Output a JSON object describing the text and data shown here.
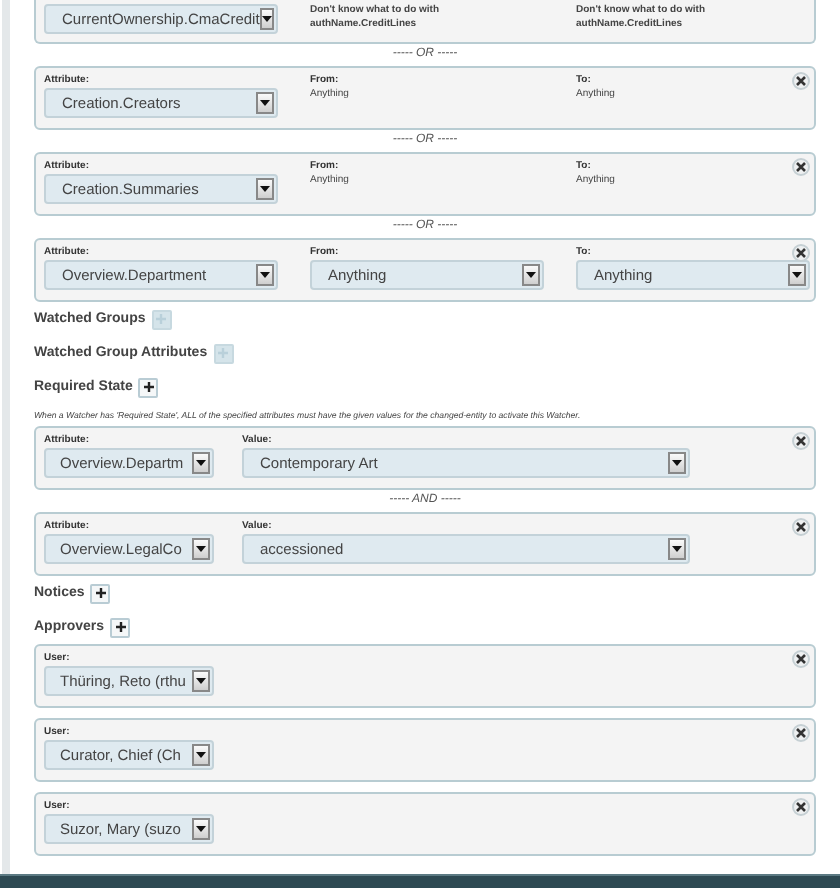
{
  "attribute_changes": {
    "items": [
      {
        "kind": "condition",
        "removable": false,
        "fields": [
          {
            "kind": "dropdown",
            "value": "CurrentOwnership.CmaCredit"
          },
          {
            "kind": "text",
            "lines": [
              "Don't know what to do with",
              "authName.CreditLines"
            ],
            "strong": true
          },
          {
            "kind": "text",
            "lines": [
              "Don't know what to do with",
              "authName.CreditLines"
            ],
            "strong": true
          }
        ]
      },
      {
        "kind": "separator",
        "text": "----- OR -----"
      },
      {
        "kind": "condition",
        "removable": true,
        "fields": [
          {
            "label": "Attribute:",
            "kind": "dropdown",
            "value": "Creation.Creators"
          },
          {
            "label": "From:",
            "kind": "text",
            "lines": [
              "Anything"
            ],
            "strong": false
          },
          {
            "label": "To:",
            "kind": "text",
            "lines": [
              "Anything"
            ],
            "strong": false
          }
        ]
      },
      {
        "kind": "separator",
        "text": "----- OR -----"
      },
      {
        "kind": "condition",
        "removable": true,
        "fields": [
          {
            "label": "Attribute:",
            "kind": "dropdown",
            "value": "Creation.Summaries"
          },
          {
            "label": "From:",
            "kind": "text",
            "lines": [
              "Anything"
            ],
            "strong": false
          },
          {
            "label": "To:",
            "kind": "text",
            "lines": [
              "Anything"
            ],
            "strong": false
          }
        ]
      },
      {
        "kind": "separator",
        "text": "----- OR -----"
      },
      {
        "kind": "condition",
        "removable": true,
        "fields": [
          {
            "label": "Attribute:",
            "kind": "dropdown",
            "value": "Overview.Department"
          },
          {
            "label": "From:",
            "kind": "dropdown",
            "value": "Anything"
          },
          {
            "label": "To:",
            "kind": "dropdown",
            "value": "Anything"
          }
        ]
      }
    ]
  },
  "sections": [
    {
      "heading": "Watched Groups",
      "add_disabled": true
    },
    {
      "heading": "Watched Group Attributes",
      "add_disabled": true
    },
    {
      "heading": "Required State",
      "add_disabled": false,
      "note": "When a Watcher has 'Required State', ALL of the specified attributes must have the given values for the changed-entity to activate this Watcher.",
      "items": [
        {
          "kind": "condition",
          "removable": true,
          "fields": [
            {
              "label": "Attribute:",
              "kind": "dropdown",
              "value": "Overview.Departm"
            },
            {
              "label": "Value:",
              "kind": "dropdown",
              "value": "Contemporary Art"
            }
          ]
        },
        {
          "kind": "separator",
          "text": "----- AND -----"
        },
        {
          "kind": "condition",
          "removable": true,
          "fields": [
            {
              "label": "Attribute:",
              "kind": "dropdown",
              "value": "Overview.LegalCo"
            },
            {
              "label": "Value:",
              "kind": "dropdown",
              "value": "accessioned"
            }
          ]
        }
      ]
    },
    {
      "heading": "Notices",
      "add_disabled": false
    },
    {
      "heading": "Approvers",
      "add_disabled": false,
      "items": [
        {
          "kind": "condition",
          "removable": true,
          "fields": [
            {
              "label": "User:",
              "kind": "dropdown",
              "value": "Thüring, Reto (rthu"
            }
          ]
        },
        {
          "kind": "condition",
          "removable": true,
          "fields": [
            {
              "label": "User:",
              "kind": "dropdown",
              "value": "Curator, Chief (Ch"
            }
          ]
        },
        {
          "kind": "condition",
          "removable": true,
          "fields": [
            {
              "label": "User:",
              "kind": "dropdown",
              "value": "Suzor, Mary (suzo"
            }
          ]
        }
      ]
    }
  ]
}
